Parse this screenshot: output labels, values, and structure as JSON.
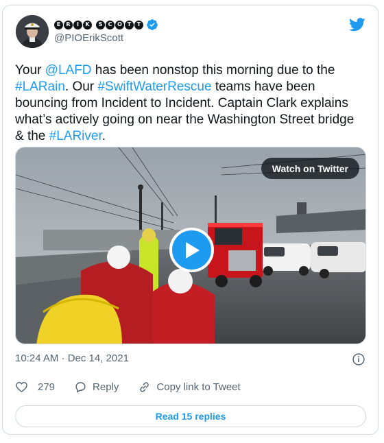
{
  "author": {
    "display_name_letters": [
      "E",
      "R",
      "I",
      "K",
      "",
      "S",
      "C",
      "O",
      "T",
      "T"
    ],
    "handle": "@PIOErikScott",
    "verified": true
  },
  "tweet": {
    "segments": [
      {
        "text": "Your ",
        "link": false
      },
      {
        "text": "@LAFD",
        "link": true
      },
      {
        "text": " has been nonstop this morning due to the ",
        "link": false
      },
      {
        "text": "#LARain",
        "link": true
      },
      {
        "text": ". Our ",
        "link": false
      },
      {
        "text": "#SwiftWaterRescue",
        "link": true
      },
      {
        "text": " teams have been bouncing from Incident to Incident. Captain Clark explains what’s actively going on near the Washington Street bridge & the ",
        "link": false
      },
      {
        "text": "#LARiver",
        "link": true
      },
      {
        "text": ".",
        "link": false
      }
    ]
  },
  "media": {
    "watch_label": "Watch on Twitter"
  },
  "timestamp": "10:24 AM · Dec 14, 2021",
  "actions": {
    "like_count": "279",
    "reply_label": "Reply",
    "copy_label": "Copy link to Tweet"
  },
  "read_replies_label": "Read 15 replies",
  "colors": {
    "link": "#1d9bf0",
    "text": "#0f1419",
    "muted": "#536471",
    "border": "#cfd9de"
  }
}
